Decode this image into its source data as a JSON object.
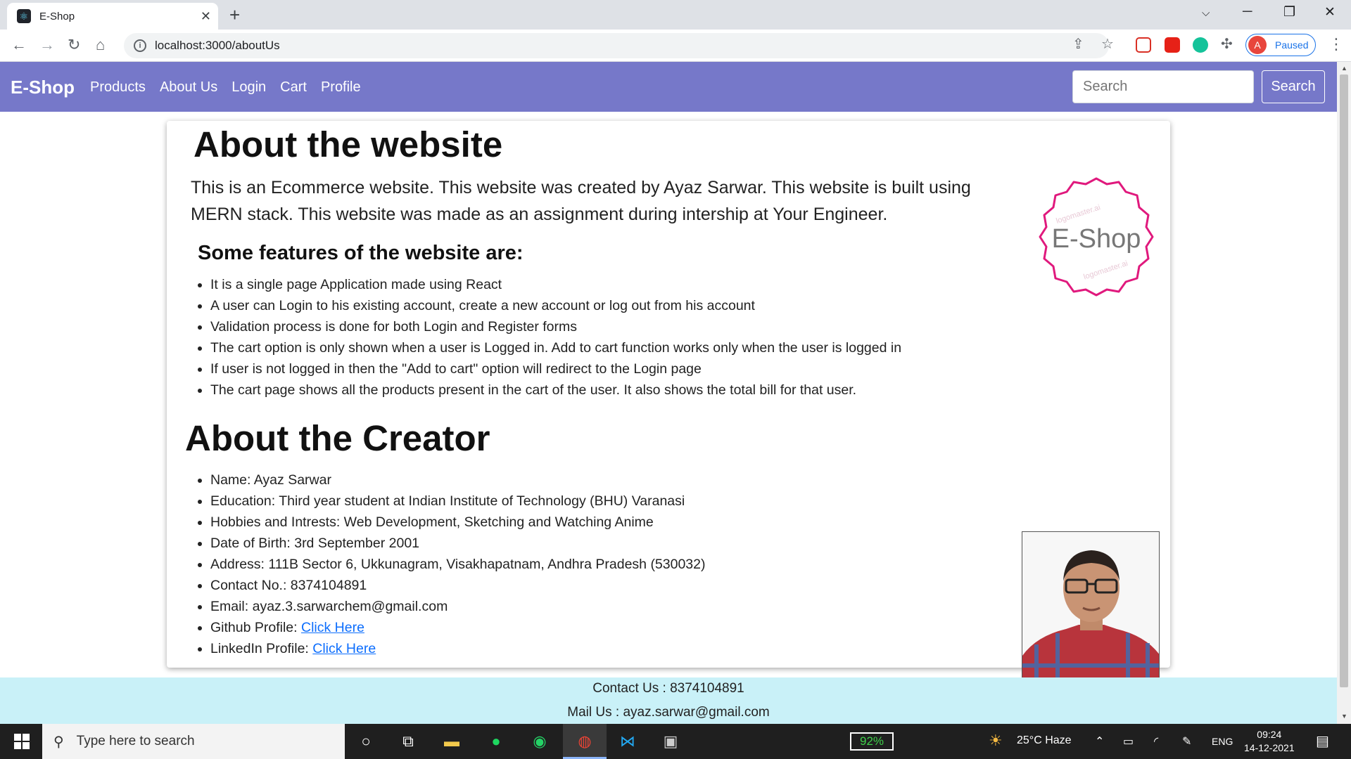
{
  "browser": {
    "tab_title": "E-Shop",
    "url": "localhost:3000/aboutUs",
    "profile_label": "Paused",
    "profile_initial": "A"
  },
  "navbar": {
    "brand": "E-Shop",
    "links": [
      "Products",
      "About Us",
      "Login",
      "Cart",
      "Profile"
    ],
    "search_placeholder": "Search",
    "search_button": "Search",
    "background_color": "#7678c9"
  },
  "about_website": {
    "heading": "About the website",
    "paragraph": "This is an Ecommerce website. This website was created by Ayaz Sarwar. This website is built using MERN stack. This website was made as an assignment during intership at Your Engineer.",
    "features_heading": "Some features of the website are:",
    "features": [
      "It is a single page Application made using React",
      "A user can Login to his existing account, create a new account or log out from his account",
      "Validation process is done for both Login and Register forms",
      "The cart option is only shown when a user is Logged in. Add to cart function works only when the user is logged in",
      "If user is not logged in then the \"Add to cart\" option will redirect to the Login page",
      "The cart page shows all the products present in the cart of the user. It also shows the total bill for that user."
    ],
    "logo_text": "E-Shop",
    "logo_watermark": "logomaster.ai"
  },
  "about_creator": {
    "heading": "About the Creator",
    "details": [
      "Name: Ayaz Sarwar",
      "Education: Third year student at Indian Institute of Technology (BHU) Varanasi",
      "Hobbies and Intrests: Web Development, Sketching and Watching Anime",
      "Date of Birth: 3rd September 2001",
      "Address: 111B Sector 6, Ukkunagram, Visakhapatnam, Andhra Pradesh (530032)",
      "Contact No.: 8374104891",
      "Email: ayaz.3.sarwarchem@gmail.com"
    ],
    "github_label": "Github Profile: ",
    "linkedin_label": "LinkedIn Profile: ",
    "link_text": "Click Here"
  },
  "footer": {
    "contact": "Contact Us : 8374104891",
    "mail": "Mail Us : ayaz.sarwar@gmail.com",
    "background_color": "#c9f1f8"
  },
  "taskbar": {
    "search_placeholder": "Type here to search",
    "battery": "92%",
    "weather": "25°C  Haze",
    "language": "ENG",
    "time": "09:24",
    "date": "14-12-2021"
  }
}
